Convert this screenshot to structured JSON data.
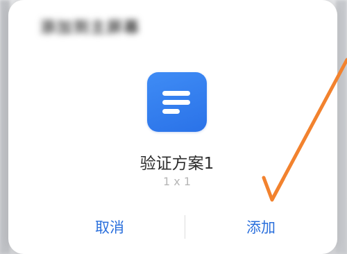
{
  "dialog": {
    "title": "添加到主屏幕",
    "widget_icon": "document-lines-icon",
    "widget_name": "验证方案1",
    "widget_size": "1 x 1",
    "cancel_label": "取消",
    "add_label": "添加"
  },
  "colors": {
    "accent": "#2a6fdc",
    "icon_bg": "#2f7bef",
    "annotation_arrow": "#f2822e"
  }
}
